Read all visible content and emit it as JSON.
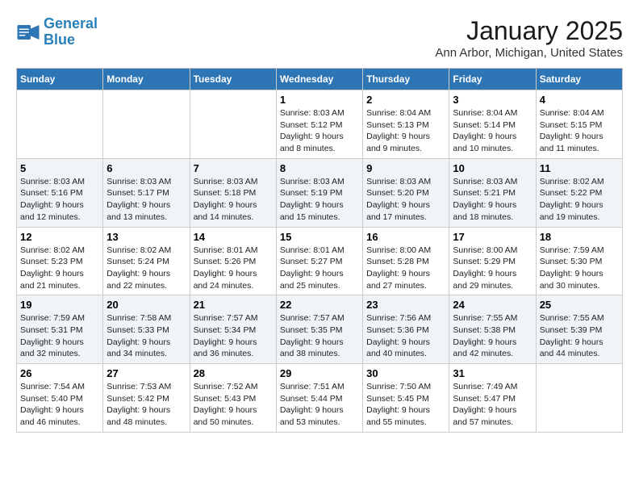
{
  "app": {
    "logo_line1": "General",
    "logo_line2": "Blue"
  },
  "header": {
    "month": "January 2025",
    "location": "Ann Arbor, Michigan, United States"
  },
  "weekdays": [
    "Sunday",
    "Monday",
    "Tuesday",
    "Wednesday",
    "Thursday",
    "Friday",
    "Saturday"
  ],
  "weeks": [
    [
      {
        "day": "",
        "sunrise": "",
        "sunset": "",
        "daylight": ""
      },
      {
        "day": "",
        "sunrise": "",
        "sunset": "",
        "daylight": ""
      },
      {
        "day": "",
        "sunrise": "",
        "sunset": "",
        "daylight": ""
      },
      {
        "day": "1",
        "sunrise": "Sunrise: 8:03 AM",
        "sunset": "Sunset: 5:12 PM",
        "daylight": "Daylight: 9 hours and 8 minutes."
      },
      {
        "day": "2",
        "sunrise": "Sunrise: 8:04 AM",
        "sunset": "Sunset: 5:13 PM",
        "daylight": "Daylight: 9 hours and 9 minutes."
      },
      {
        "day": "3",
        "sunrise": "Sunrise: 8:04 AM",
        "sunset": "Sunset: 5:14 PM",
        "daylight": "Daylight: 9 hours and 10 minutes."
      },
      {
        "day": "4",
        "sunrise": "Sunrise: 8:04 AM",
        "sunset": "Sunset: 5:15 PM",
        "daylight": "Daylight: 9 hours and 11 minutes."
      }
    ],
    [
      {
        "day": "5",
        "sunrise": "Sunrise: 8:03 AM",
        "sunset": "Sunset: 5:16 PM",
        "daylight": "Daylight: 9 hours and 12 minutes."
      },
      {
        "day": "6",
        "sunrise": "Sunrise: 8:03 AM",
        "sunset": "Sunset: 5:17 PM",
        "daylight": "Daylight: 9 hours and 13 minutes."
      },
      {
        "day": "7",
        "sunrise": "Sunrise: 8:03 AM",
        "sunset": "Sunset: 5:18 PM",
        "daylight": "Daylight: 9 hours and 14 minutes."
      },
      {
        "day": "8",
        "sunrise": "Sunrise: 8:03 AM",
        "sunset": "Sunset: 5:19 PM",
        "daylight": "Daylight: 9 hours and 15 minutes."
      },
      {
        "day": "9",
        "sunrise": "Sunrise: 8:03 AM",
        "sunset": "Sunset: 5:20 PM",
        "daylight": "Daylight: 9 hours and 17 minutes."
      },
      {
        "day": "10",
        "sunrise": "Sunrise: 8:03 AM",
        "sunset": "Sunset: 5:21 PM",
        "daylight": "Daylight: 9 hours and 18 minutes."
      },
      {
        "day": "11",
        "sunrise": "Sunrise: 8:02 AM",
        "sunset": "Sunset: 5:22 PM",
        "daylight": "Daylight: 9 hours and 19 minutes."
      }
    ],
    [
      {
        "day": "12",
        "sunrise": "Sunrise: 8:02 AM",
        "sunset": "Sunset: 5:23 PM",
        "daylight": "Daylight: 9 hours and 21 minutes."
      },
      {
        "day": "13",
        "sunrise": "Sunrise: 8:02 AM",
        "sunset": "Sunset: 5:24 PM",
        "daylight": "Daylight: 9 hours and 22 minutes."
      },
      {
        "day": "14",
        "sunrise": "Sunrise: 8:01 AM",
        "sunset": "Sunset: 5:26 PM",
        "daylight": "Daylight: 9 hours and 24 minutes."
      },
      {
        "day": "15",
        "sunrise": "Sunrise: 8:01 AM",
        "sunset": "Sunset: 5:27 PM",
        "daylight": "Daylight: 9 hours and 25 minutes."
      },
      {
        "day": "16",
        "sunrise": "Sunrise: 8:00 AM",
        "sunset": "Sunset: 5:28 PM",
        "daylight": "Daylight: 9 hours and 27 minutes."
      },
      {
        "day": "17",
        "sunrise": "Sunrise: 8:00 AM",
        "sunset": "Sunset: 5:29 PM",
        "daylight": "Daylight: 9 hours and 29 minutes."
      },
      {
        "day": "18",
        "sunrise": "Sunrise: 7:59 AM",
        "sunset": "Sunset: 5:30 PM",
        "daylight": "Daylight: 9 hours and 30 minutes."
      }
    ],
    [
      {
        "day": "19",
        "sunrise": "Sunrise: 7:59 AM",
        "sunset": "Sunset: 5:31 PM",
        "daylight": "Daylight: 9 hours and 32 minutes."
      },
      {
        "day": "20",
        "sunrise": "Sunrise: 7:58 AM",
        "sunset": "Sunset: 5:33 PM",
        "daylight": "Daylight: 9 hours and 34 minutes."
      },
      {
        "day": "21",
        "sunrise": "Sunrise: 7:57 AM",
        "sunset": "Sunset: 5:34 PM",
        "daylight": "Daylight: 9 hours and 36 minutes."
      },
      {
        "day": "22",
        "sunrise": "Sunrise: 7:57 AM",
        "sunset": "Sunset: 5:35 PM",
        "daylight": "Daylight: 9 hours and 38 minutes."
      },
      {
        "day": "23",
        "sunrise": "Sunrise: 7:56 AM",
        "sunset": "Sunset: 5:36 PM",
        "daylight": "Daylight: 9 hours and 40 minutes."
      },
      {
        "day": "24",
        "sunrise": "Sunrise: 7:55 AM",
        "sunset": "Sunset: 5:38 PM",
        "daylight": "Daylight: 9 hours and 42 minutes."
      },
      {
        "day": "25",
        "sunrise": "Sunrise: 7:55 AM",
        "sunset": "Sunset: 5:39 PM",
        "daylight": "Daylight: 9 hours and 44 minutes."
      }
    ],
    [
      {
        "day": "26",
        "sunrise": "Sunrise: 7:54 AM",
        "sunset": "Sunset: 5:40 PM",
        "daylight": "Daylight: 9 hours and 46 minutes."
      },
      {
        "day": "27",
        "sunrise": "Sunrise: 7:53 AM",
        "sunset": "Sunset: 5:42 PM",
        "daylight": "Daylight: 9 hours and 48 minutes."
      },
      {
        "day": "28",
        "sunrise": "Sunrise: 7:52 AM",
        "sunset": "Sunset: 5:43 PM",
        "daylight": "Daylight: 9 hours and 50 minutes."
      },
      {
        "day": "29",
        "sunrise": "Sunrise: 7:51 AM",
        "sunset": "Sunset: 5:44 PM",
        "daylight": "Daylight: 9 hours and 53 minutes."
      },
      {
        "day": "30",
        "sunrise": "Sunrise: 7:50 AM",
        "sunset": "Sunset: 5:45 PM",
        "daylight": "Daylight: 9 hours and 55 minutes."
      },
      {
        "day": "31",
        "sunrise": "Sunrise: 7:49 AM",
        "sunset": "Sunset: 5:47 PM",
        "daylight": "Daylight: 9 hours and 57 minutes."
      },
      {
        "day": "",
        "sunrise": "",
        "sunset": "",
        "daylight": ""
      }
    ]
  ]
}
